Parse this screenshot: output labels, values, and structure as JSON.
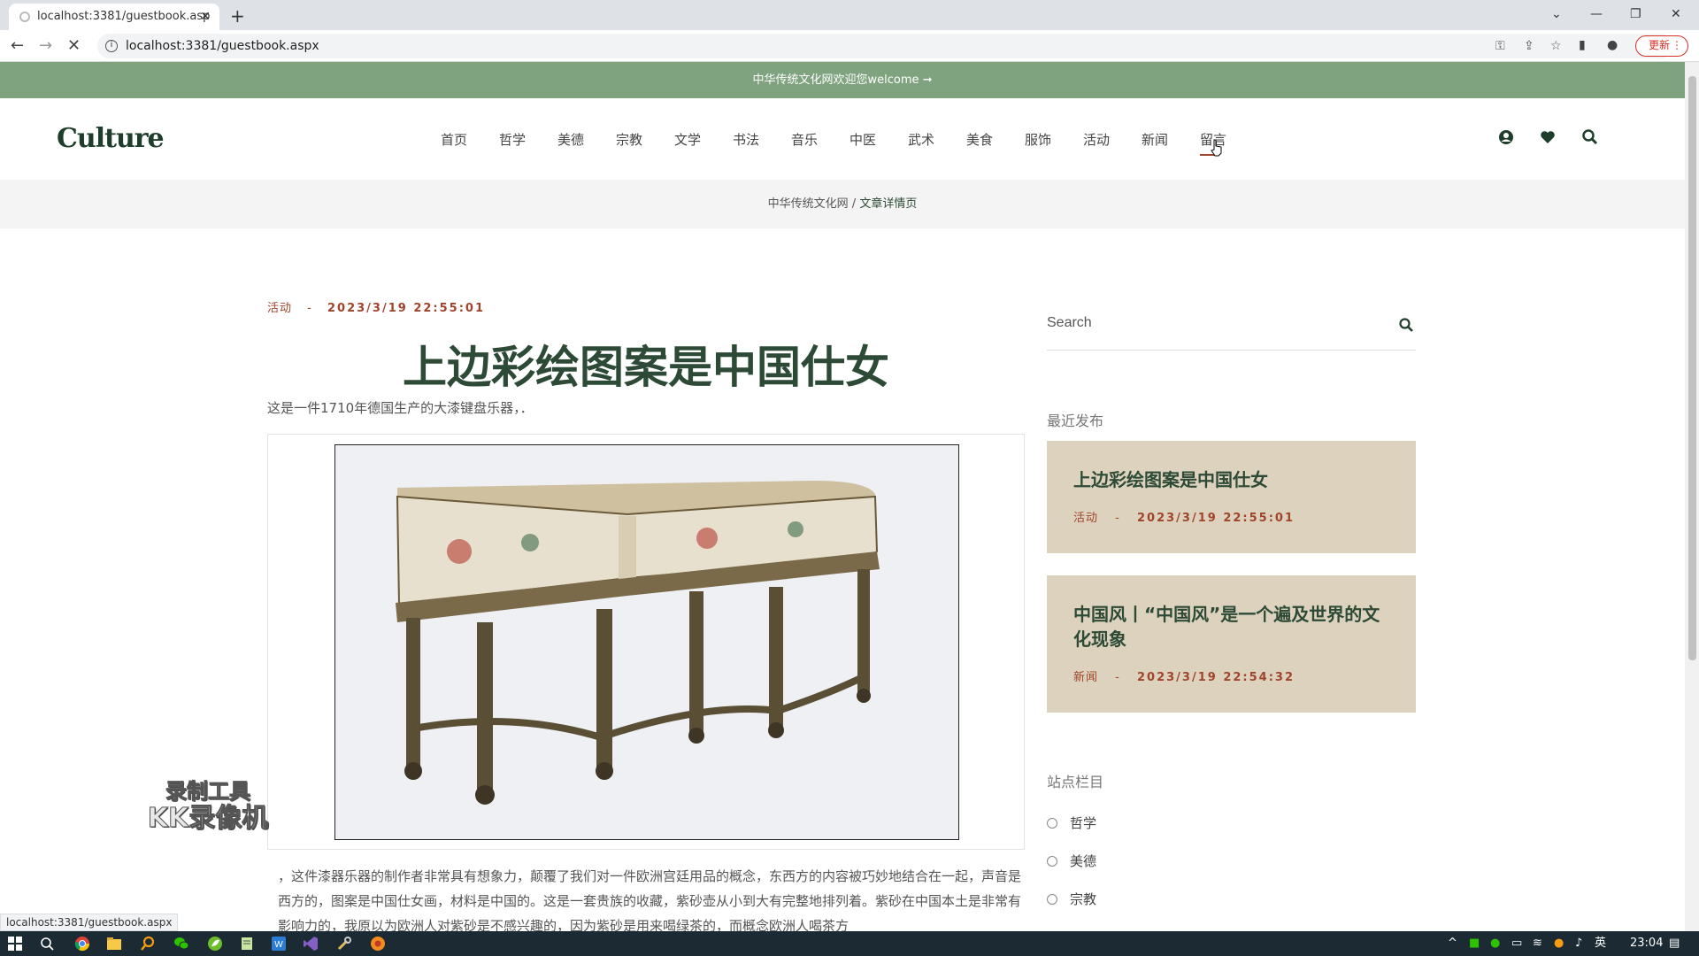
{
  "browser": {
    "tab_title": "localhost:3381/guestbook.asp",
    "url": "localhost:3381/guestbook.aspx",
    "update_label": "更新",
    "status_url": "localhost:3381/guestbook.aspx"
  },
  "site": {
    "announcement": "中华传统文化网欢迎您welcome ➞",
    "logo": "Culture",
    "nav": [
      "首页",
      "哲学",
      "美德",
      "宗教",
      "文学",
      "书法",
      "音乐",
      "中医",
      "武术",
      "美食",
      "服饰",
      "活动",
      "新闻",
      "留言"
    ],
    "active_nav": "留言",
    "breadcrumb": {
      "home": "中华传统文化网",
      "sep": " / ",
      "current": "文章详情页"
    }
  },
  "article": {
    "category": "活动",
    "sep": "-",
    "date": "2023/3/19 22:55:01",
    "title": "上边彩绘图案是中国仕女",
    "lead": "这是一件1710年德国生产的大漆键盘乐器，．",
    "image_alt": "painted harpsichord",
    "body": "，这件漆器乐器的制作者非常具有想象力，颠覆了我们对一件欧洲宫廷用品的概念，东西方的内容被巧妙地结合在一起，声音是西方的，图案是中国仕女画，材料是中国的。这是一套贵族的收藏，紫砂壶从小到大有完整地排列着。紫砂在中国本土是非常有影响力的，我原以为欧洲人对紫砂是不感兴趣的，因为紫砂是用来喝绿茶的，而概念欧洲人喝茶方"
  },
  "sidebar": {
    "search_placeholder": "Search",
    "recent_heading": "最近发布",
    "recent": [
      {
        "title": "上边彩绘图案是中国仕女",
        "category": "活动",
        "date": "2023/3/19 22:55:01"
      },
      {
        "title": "中国风丨“中国风”是一个遍及世界的文化现象",
        "category": "新闻",
        "date": "2023/3/19 22:54:32"
      }
    ],
    "categories_heading": "站点栏目",
    "categories": [
      "哲学",
      "美德",
      "宗教"
    ]
  },
  "watermark": {
    "line1": "录制工具",
    "line2": "KK录像机"
  },
  "taskbar": {
    "ime": "英",
    "time": "23:04"
  },
  "colors": {
    "announce_bg": "#7fa37f",
    "title_green": "#2c4a35",
    "accent_red": "#a0442b",
    "card_bg": "#ddd2bd"
  }
}
